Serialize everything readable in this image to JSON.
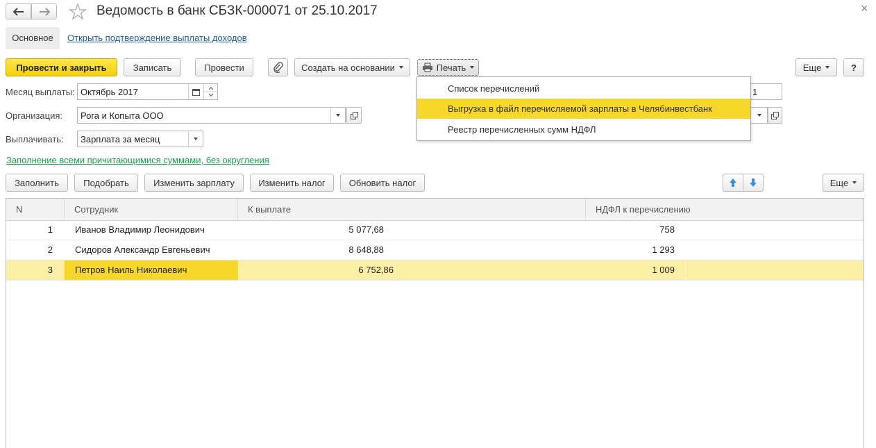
{
  "header": {
    "title": "Ведомость в банк СБЗК-000071 от 25.10.2017",
    "close_glyph": "×"
  },
  "tabs": {
    "main": "Основное",
    "link": "Открыть подтверждение выплаты доходов"
  },
  "toolbar": {
    "post_close": "Провести и закрыть",
    "save": "Записать",
    "post": "Провести",
    "create_based": "Создать на основании",
    "print": "Печать",
    "more": "Еще",
    "help": "?"
  },
  "fields": {
    "month_label": "Месяц выплаты:",
    "month_value": "Октябрь 2017",
    "org_label": "Организация:",
    "org_value": "Рога и Копыта ООО",
    "pay_label": "Выплачивать:",
    "pay_value": "Зарплата за месяц",
    "right_fragment": "1"
  },
  "fill_link": "Заполнение всеми причитающимися суммами, без округления",
  "table_toolbar": {
    "fill": "Заполнить",
    "pick": "Подобрать",
    "change_salary": "Изменить зарплату",
    "change_tax": "Изменить налог",
    "update_tax": "Обновить налог",
    "more": "Еще"
  },
  "table": {
    "headers": [
      "N",
      "Сотрудник",
      "К выплате",
      "НДФЛ к перечислению"
    ],
    "rows": [
      {
        "n": "1",
        "employee": "Иванов Владимир Леонидович",
        "amount": "5 077,68",
        "tax": "758"
      },
      {
        "n": "2",
        "employee": "Сидоров Александр Евгеньевич",
        "amount": "8 648,88",
        "tax": "1 293"
      },
      {
        "n": "3",
        "employee": "Петров Наиль Николаевич",
        "amount": "6 752,86",
        "tax": "1 009"
      }
    ]
  },
  "print_menu": {
    "items": [
      "Список перечислений",
      "Выгрузка в файл перечисляемой зарплаты в Челябинвестбанк",
      "Реестр перечисленных сумм НДФЛ"
    ]
  },
  "colors": {
    "accent_yellow": "#f4cf0d",
    "selection": "#fbefa6",
    "selected_cell": "#f7d82a",
    "link_blue": "#1f5ea6",
    "link_green": "#17a34a"
  }
}
